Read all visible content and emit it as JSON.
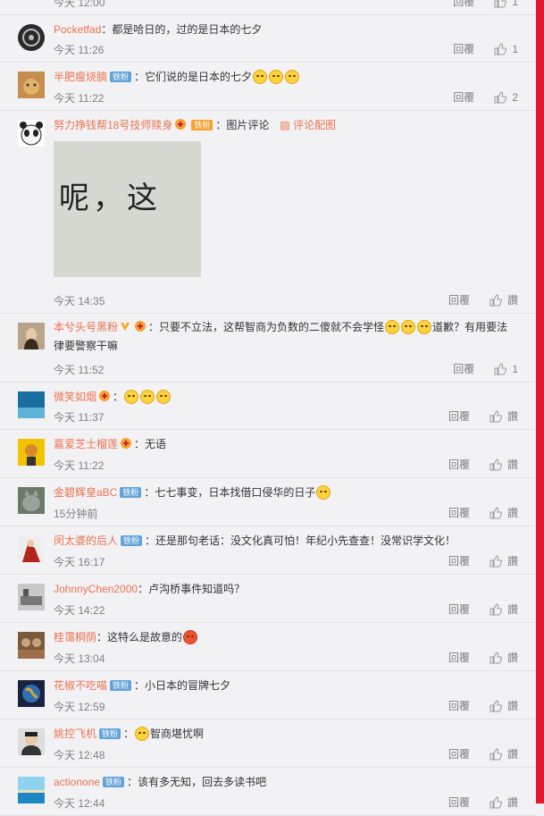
{
  "reply_label": "回覆",
  "like_label": "讚",
  "fan_badge": "铁粉",
  "colors": {
    "accent": "#eb7350",
    "badge": "#62a4d8",
    "sidebar": "#e6162d"
  },
  "top": {
    "time": "今天 12:00",
    "likes": "1"
  },
  "comments": [
    {
      "user": "Pocketfad",
      "text": "：都是哈日的，过的是日本的七夕",
      "time": "今天 11:26",
      "likes": "1",
      "avatar": "dark"
    },
    {
      "user": "半肥瘦烧腩",
      "badge": true,
      "text": "：它们说的是日本的七夕",
      "emojis": 3,
      "time": "今天 11:22",
      "likes": "2",
      "avatar": "cat"
    },
    {
      "user": "努力挣钱帮18号技师赎身",
      "badge": true,
      "text": "：图片评论",
      "pic_link": "评论配图",
      "image_text": "呢，这",
      "time": "今天 14:35",
      "likes": "讚",
      "avatar": "panda"
    },
    {
      "user": "本兮头号黑粉",
      "vip": true,
      "medal": true,
      "text": "：只要不立法，这帮智商为负数的二傻就不会学怪",
      "emojis": 3,
      "text2": "道歉？有用要法律要警察干嘛",
      "time": "今天 11:52",
      "likes": "1",
      "avatar": "girl"
    },
    {
      "user": "微笑如烟",
      "medal": true,
      "text": "：",
      "emojis": 3,
      "time": "今天 11:37",
      "likes": "讚",
      "avatar": "blue"
    },
    {
      "user": "嘉爱芝士榴莲",
      "medal": true,
      "text": "：无语",
      "time": "今天 11:22",
      "likes": "讚",
      "avatar": "yellow"
    },
    {
      "user": "金碧辉皇aBC",
      "badge": true,
      "text": "：七七事变，日本找借口侵华的日子",
      "emojis": 1,
      "time": "15分钟前",
      "likes": "讚",
      "avatar": "catgray"
    },
    {
      "user": "闵太婆的后人",
      "badge": true,
      "text": "：还是那句老话：没文化真可怕！年纪小先查查！没常识学文化！",
      "time": "今天 16:17",
      "likes": "讚",
      "avatar": "red"
    },
    {
      "user": "JohnnyChen2000",
      "text": "：卢沟桥事件知道吗？",
      "time": "今天 14:22",
      "likes": "讚",
      "avatar": "gray"
    },
    {
      "user": "桂霭桐荫",
      "text": "：这特么是故意的",
      "emojis": 1,
      "angry": true,
      "time": "今天 13:04",
      "likes": "讚",
      "avatar": "brown"
    },
    {
      "user": "花椒不吃喵",
      "badge": true,
      "text": "：小日本的冒牌七夕",
      "time": "今天 12:59",
      "likes": "讚",
      "avatar": "globe"
    },
    {
      "user": "姚控飞机",
      "badge": true,
      "text": "：",
      "emojis": 1,
      "text2b": "智商堪忧啊",
      "time": "今天 12:48",
      "likes": "讚",
      "avatar": "man"
    },
    {
      "user": "actionone",
      "badge": true,
      "text": "：该有多无知，回去多读书吧",
      "time": "今天 12:44",
      "likes": "讚",
      "avatar": "sea"
    }
  ]
}
